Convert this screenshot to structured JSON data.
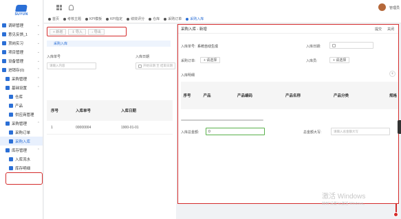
{
  "brand": {
    "logo_text": "SUYUN"
  },
  "sidebar": {
    "items": [
      {
        "label": "调研管理",
        "icon": "survey-icon"
      },
      {
        "label": "意见反馈_1",
        "icon": "feedback-icon"
      },
      {
        "label": "顶岗实习",
        "icon": "internship-icon"
      },
      {
        "label": "项目管理",
        "icon": "project-icon"
      },
      {
        "label": "设备管理",
        "icon": "device-icon"
      },
      {
        "label": "进销存(0)",
        "icon": "inventory-icon"
      },
      {
        "label": "采购管理",
        "icon": "purchase-icon"
      },
      {
        "label": "基础设置",
        "icon": "settings-icon"
      },
      {
        "label": "仓库",
        "icon": "warehouse-icon"
      },
      {
        "label": "产品",
        "icon": "product-icon"
      },
      {
        "label": "供应商管理",
        "icon": "supplier-icon"
      },
      {
        "label": "采购管理",
        "icon": "purchase-sub-icon"
      },
      {
        "label": "采购订单",
        "icon": "order-icon"
      },
      {
        "label": "采购入库",
        "icon": "inbound-icon"
      },
      {
        "label": "库存管理",
        "icon": "stock-icon"
      },
      {
        "label": "入库流水",
        "icon": "inbound-flow-icon"
      },
      {
        "label": "库存明细",
        "icon": "stock-detail-icon"
      }
    ]
  },
  "topbar": {
    "username": "管理员"
  },
  "tabs": [
    {
      "label": "首页"
    },
    {
      "label": "考核主题"
    },
    {
      "label": "KPI模板"
    },
    {
      "label": "KPI指定"
    },
    {
      "label": "绩效评分"
    },
    {
      "label": "仓库"
    },
    {
      "label": "采购订单"
    },
    {
      "label": "采购入库"
    }
  ],
  "list": {
    "toolbar": {
      "add": "+ 新增",
      "import": "↥ 导入",
      "export": "↓ 导出"
    },
    "subtab": "采购入库",
    "filters": {
      "order_no_label": "入库单号",
      "order_no_placeholder": "请输入内容",
      "date_label": "入库日期",
      "date_placeholder": "开始日期 至 结束日期"
    },
    "columns": [
      "序号",
      "入库单号",
      "入库日期"
    ],
    "rows": [
      {
        "index": "1",
        "order_no": "00000004",
        "date": "1900-01-01"
      }
    ]
  },
  "modal": {
    "title": "采购入库 - 新增",
    "submit": "提交",
    "close": "关闭",
    "order_no_label": "入库单号:",
    "order_no_value": "系统自动生成",
    "date_label": "入库日期:",
    "purchase_order_label": "采购订单:",
    "purchase_order_btn": "+ 请选择",
    "staff_label": "入库员:",
    "staff_btn": "+ 请选择",
    "detail_section": "入库明细",
    "add_row": "+",
    "columns": [
      "序号",
      "产品",
      "产品编码",
      "产品名称",
      "产品分类",
      "规格"
    ],
    "amount_label": "入库总金额:",
    "amount_value": "0",
    "upper_label": "总金额大写:",
    "upper_placeholder": "请输入总金额大写"
  },
  "watermark": {
    "line1": "激活 Windows",
    "line2": "转到\"设置\"以激活 Windows。"
  },
  "colors": {
    "accent": "#2b6fd6",
    "highlight": "#d42a2a"
  }
}
